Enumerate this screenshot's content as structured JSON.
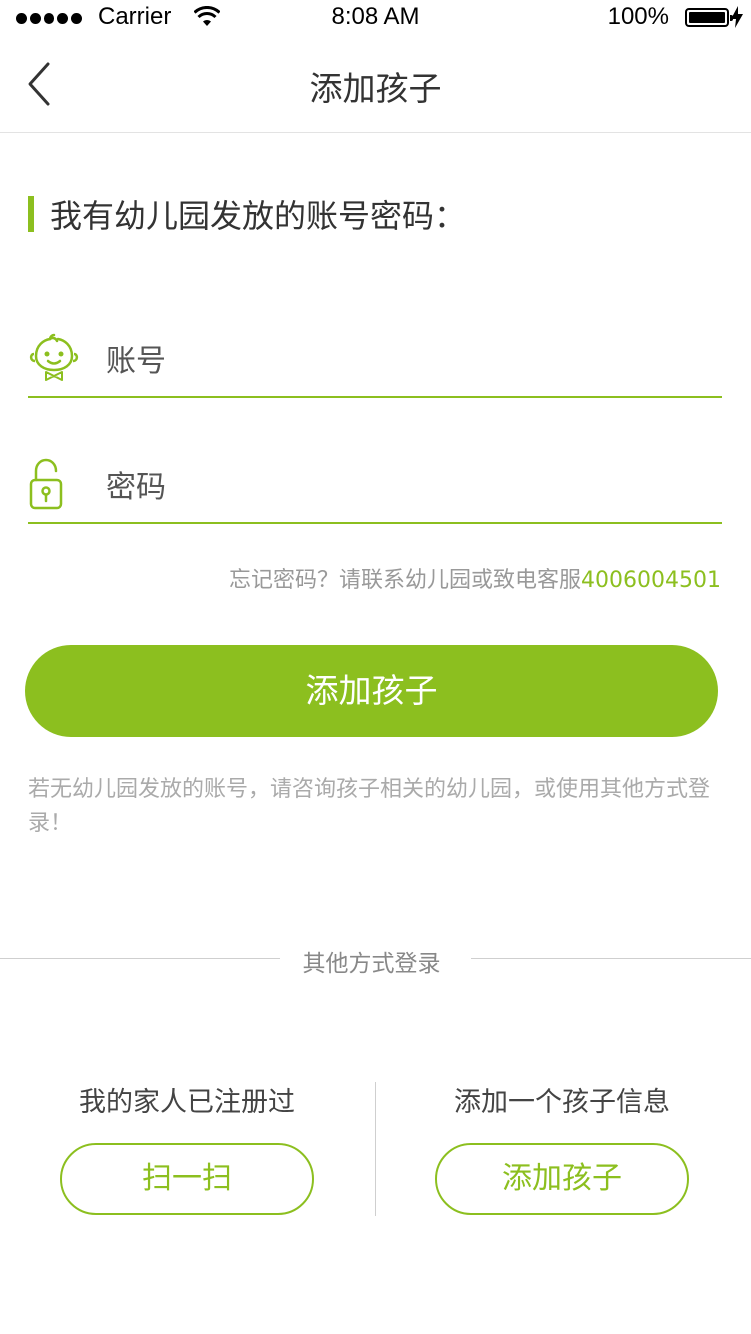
{
  "status_bar": {
    "carrier": "Carrier",
    "time": "8:08 AM",
    "battery": "100%",
    "icons": [
      "signal-dots-icon",
      "wifi-icon",
      "battery-icon",
      "charging-bolt-icon"
    ]
  },
  "nav": {
    "back_icon": "chevron-left-icon",
    "title": "添加孩子"
  },
  "section": {
    "title": "我有幼儿园发放的账号密码："
  },
  "form": {
    "account_placeholder": "账号",
    "account_icon": "child-face-icon",
    "password_placeholder": "密码",
    "password_icon": "lock-icon"
  },
  "forgot": {
    "text": "忘记密码？请联系幼儿园或致电客服",
    "phone": "4006004501"
  },
  "primary_button": "添加孩子",
  "hint": "若无幼儿园发放的账号，请咨询孩子相关的幼儿园，或使用其他方式登录！",
  "other_login": {
    "divider": "其他方式登录",
    "left": {
      "title": "我的家人已注册过",
      "button": "扫一扫"
    },
    "right": {
      "title": "添加一个孩子信息",
      "button": "添加孩子"
    }
  },
  "colors": {
    "accent": "#8cbf1f",
    "title_text": "#333333",
    "muted_text": "#999999",
    "divider": "#cfcfcf"
  }
}
